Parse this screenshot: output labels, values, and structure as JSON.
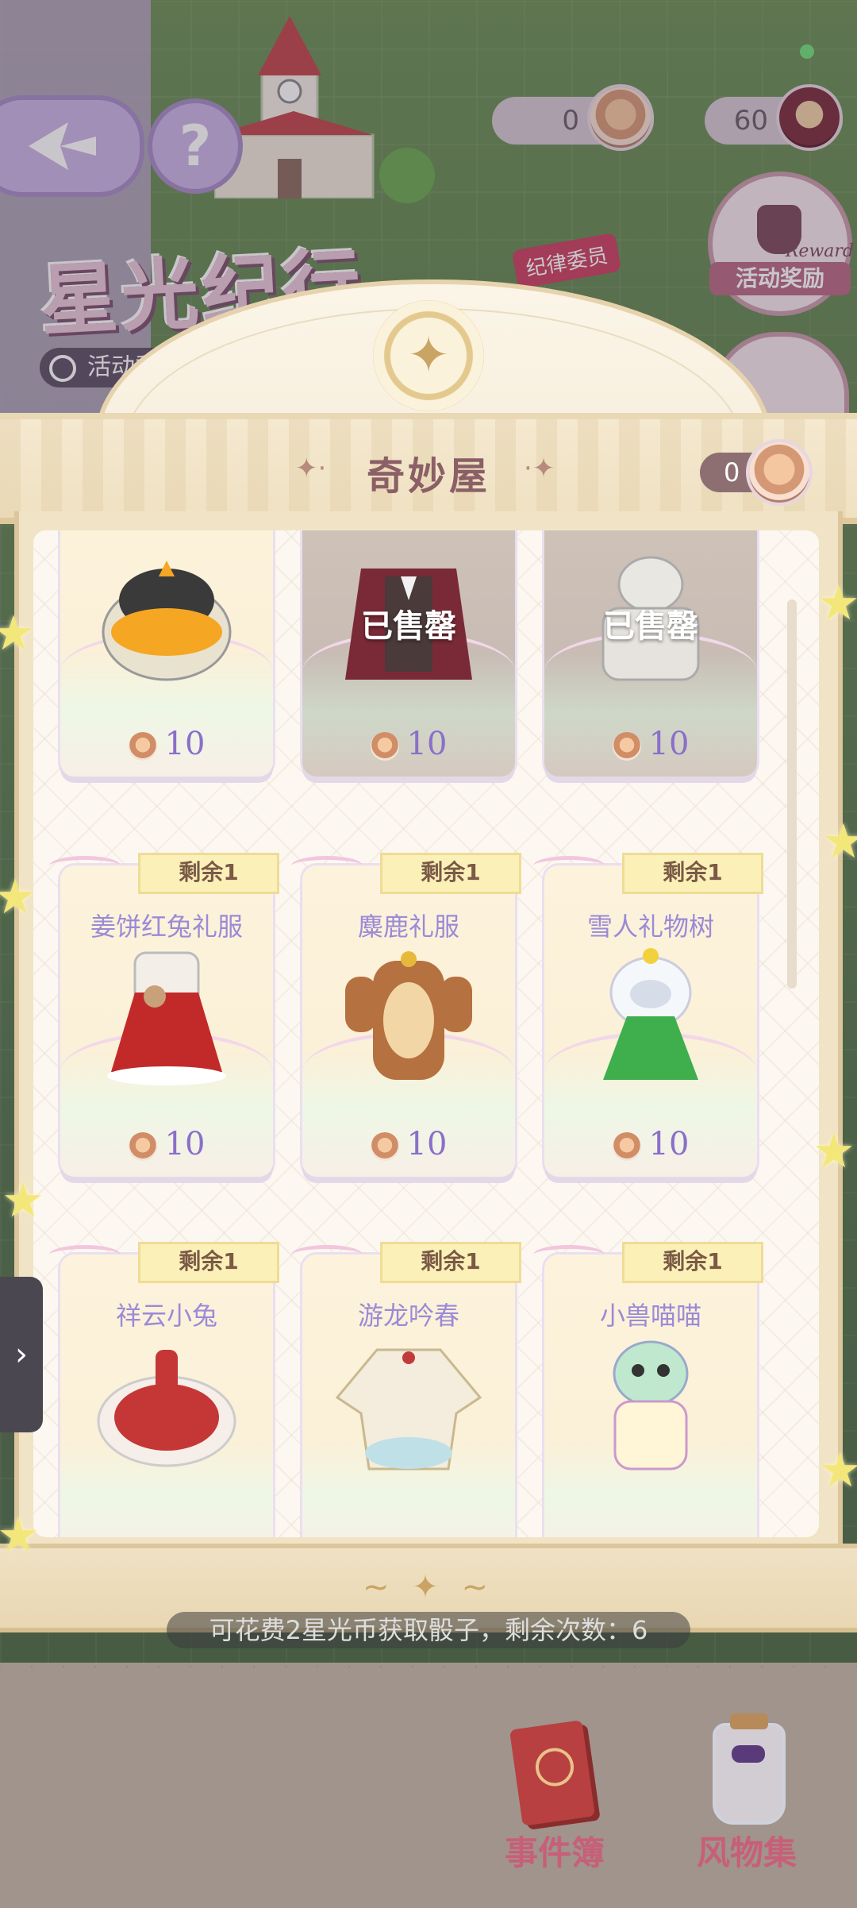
{
  "background": {
    "logo_text": "星光纪行",
    "timer_text": "活动剩",
    "cat_badge": "纪律委员",
    "help_glyph": "?",
    "currency_pill_1": "0",
    "currency_pill_2": "60",
    "reward_label": "活动奖励",
    "reward_en": "Reward"
  },
  "shop": {
    "title": "奇妙屋",
    "title_deco_left": "✦·",
    "title_deco_right": "·✦",
    "my_coins": "0",
    "sold_label": "已售罄",
    "stock_label": "剩余1",
    "price": "10",
    "items": [
      {
        "name": "",
        "price": "10",
        "sold": false,
        "stock": ""
      },
      {
        "name": "",
        "price": "10",
        "sold": true,
        "stock": ""
      },
      {
        "name": "",
        "price": "10",
        "sold": true,
        "stock": ""
      },
      {
        "name": "姜饼红兔礼服",
        "price": "10",
        "sold": false,
        "stock": "剩余1"
      },
      {
        "name": "麋鹿礼服",
        "price": "10",
        "sold": false,
        "stock": "剩余1"
      },
      {
        "name": "雪人礼物树",
        "price": "10",
        "sold": false,
        "stock": "剩余1"
      },
      {
        "name": "祥云小兔",
        "price": "",
        "sold": false,
        "stock": "剩余1"
      },
      {
        "name": "游龙吟春",
        "price": "",
        "sold": false,
        "stock": "剩余1"
      },
      {
        "name": "小兽喵喵",
        "price": "",
        "sold": false,
        "stock": "剩余1"
      }
    ]
  },
  "side_tab": "›",
  "dice_hint": "可花费2星光币获取骰子，剩余次数：6",
  "bottom_nav": {
    "events_label": "事件簿",
    "collection_label": "风物集"
  },
  "colors": {
    "title": "#8a5f66",
    "item_name": "#9b8ad6",
    "price": "#8a6fc9",
    "stock_tag": "#fbf0b8",
    "bottom_label": "#c75f78"
  },
  "icons": [
    "back-arrow-icon",
    "help-icon",
    "coin-icon",
    "reward-icon",
    "emblem-star-icon",
    "chevron-right-icon",
    "book-icon",
    "jar-icon"
  ]
}
